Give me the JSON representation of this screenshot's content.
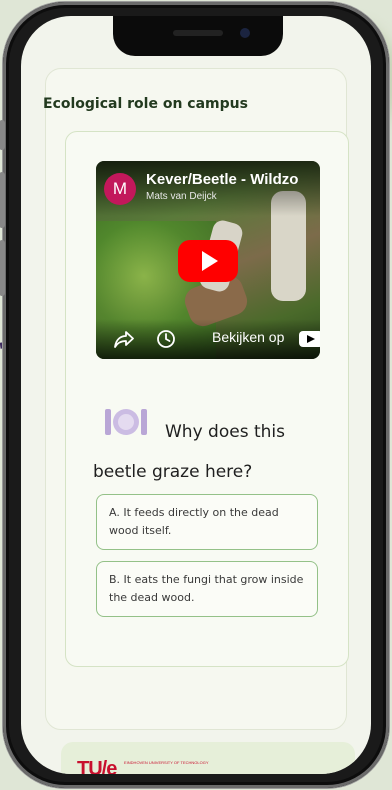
{
  "section": {
    "title": "Ecological role on campus"
  },
  "video": {
    "avatar_letter": "M",
    "title": "Kever/Beetle - Wildzo",
    "channel": "Mats van Deijck",
    "watch_label": "Bekijken op"
  },
  "quiz": {
    "question": "Why does this beetle graze here?",
    "answers": [
      {
        "text": "A. It feeds directly on the dead wood itself."
      },
      {
        "text": "B. It eats the fungi that grow inside the dead wood."
      }
    ]
  },
  "footer": {
    "logo_text": "TU/e",
    "logo_sub": "EINDHOVEN UNIVERSITY OF TECHNOLOGY"
  },
  "colors": {
    "accent": "#233a1f",
    "answer_border": "#94c188",
    "youtube_red": "#ff0000",
    "tue_red": "#c8102e"
  }
}
